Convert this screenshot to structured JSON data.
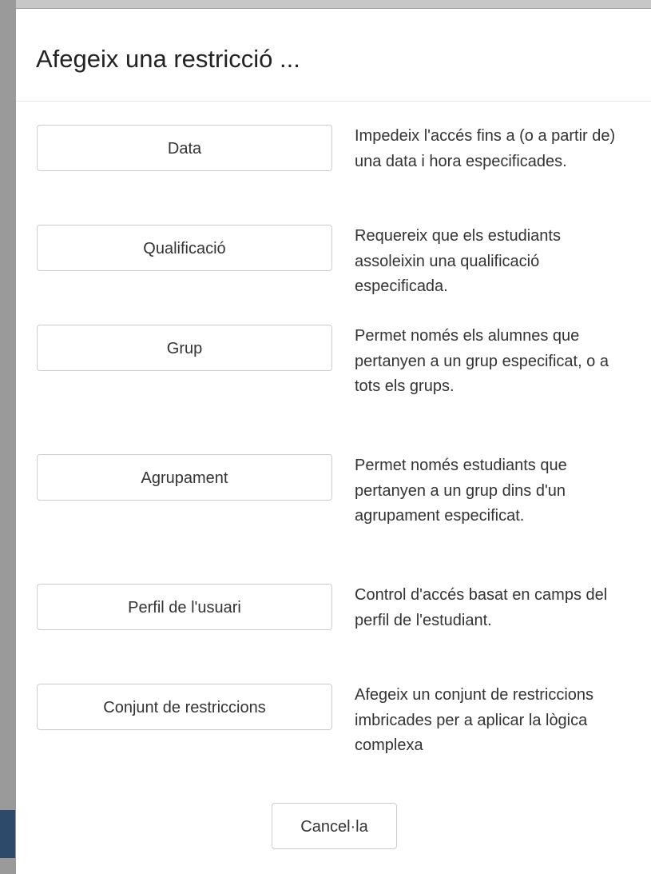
{
  "dialog": {
    "title": "Afegeix una restricció ...",
    "options": [
      {
        "label": "Data",
        "description": "Impedeix l'accés fins a (o a partir de) una data i hora especificades."
      },
      {
        "label": "Qualificació",
        "description": "Requereix que els estudiants assoleixin una qualificació especificada."
      },
      {
        "label": "Grup",
        "description": "Permet només els alumnes que pertanyen a un grup especificat, o a tots els grups."
      },
      {
        "label": "Agrupament",
        "description": "Permet només estudiants que pertanyen a un grup dins d'un agrupament especificat."
      },
      {
        "label": "Perfil de l'usuari",
        "description": "Control d'accés basat en camps del perfil de l'estudiant."
      },
      {
        "label": "Conjunt de restriccions",
        "description": "Afegeix un conjunt de restriccions imbricades per a aplicar la lògica complexa"
      }
    ],
    "cancel_label": "Cancel·la"
  }
}
